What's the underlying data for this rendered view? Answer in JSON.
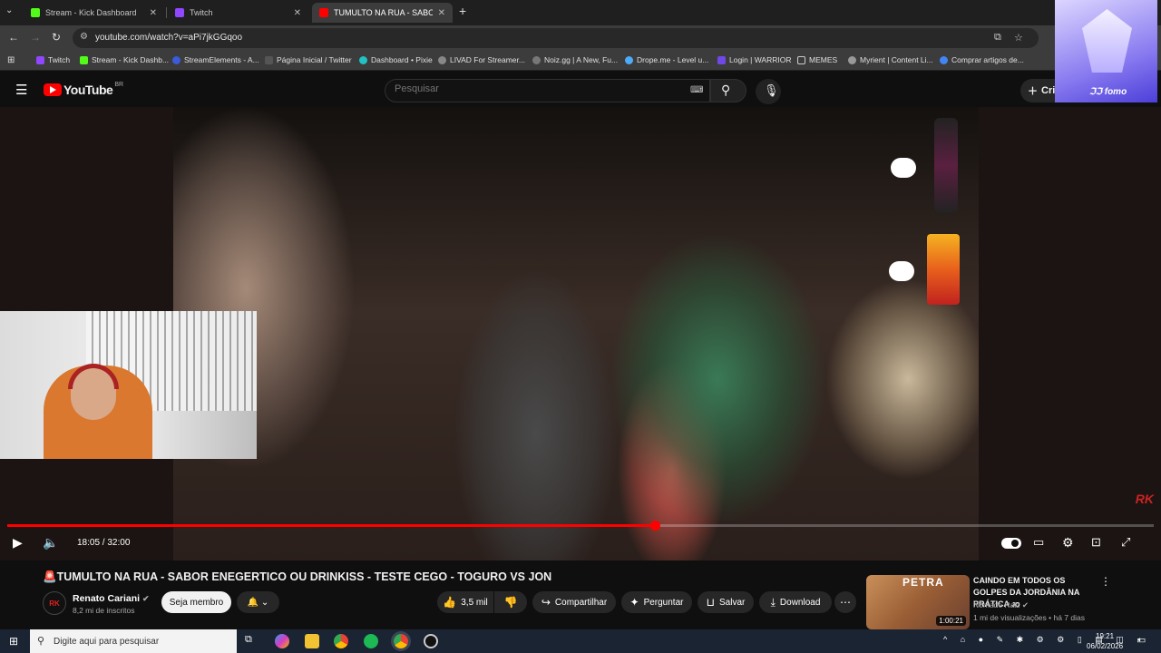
{
  "browser": {
    "tabs": [
      {
        "label": "Stream - Kick Dashboard",
        "color": "#53fc18"
      },
      {
        "label": "Twitch",
        "color": "#9146ff"
      },
      {
        "label": "TUMULTO NA RUA - SABOR",
        "color": "#ff0000"
      }
    ],
    "url": "youtube.com/watch?v=aPi7jkGGqoo",
    "bookmarks": [
      {
        "label": "Twitch",
        "color": "#9146ff"
      },
      {
        "label": "Stream - Kick Dashb...",
        "color": "#53fc18"
      },
      {
        "label": "StreamElements - A...",
        "color": "#3b5bdb"
      },
      {
        "label": "Página Inicial / Twitter",
        "color": "#555555"
      },
      {
        "label": "Dashboard • Pixie",
        "color": "#22c1c3"
      },
      {
        "label": "LIVAD For Streamer...",
        "color": "#888888"
      },
      {
        "label": "Noiz.gg | A New, Fu...",
        "color": "#777777"
      },
      {
        "label": "Drope.me - Level u...",
        "color": "#4dabf7"
      },
      {
        "label": "Login | WARRIOR",
        "color": "#7048e8"
      },
      {
        "label": "MEMES",
        "color": "#cccccc"
      },
      {
        "label": "Myrient | Content Li...",
        "color": "#999999"
      },
      {
        "label": "Comprar artigos de...",
        "color": "#4285f4"
      }
    ]
  },
  "youtube": {
    "logo": "YouTube",
    "region": "BR",
    "search_placeholder": "Pesquisar",
    "create_label": "Cri"
  },
  "player": {
    "time": "18:05 / 32:00",
    "progress": 0.565,
    "watermark": "RK"
  },
  "video": {
    "title": "🚨TUMULTO NA RUA - SABOR ENEGERTICO OU DRINKISS - TESTE CEGO - TOGURO VS JON",
    "channel": "Renato Cariani",
    "channel_initials": "RK",
    "subscribers": "8,2 mi de inscritos",
    "join_label": "Seja membro",
    "likes": "3,5 mil",
    "share_label": "Compartilhar",
    "ask_label": "Perguntar",
    "save_label": "Salvar",
    "download_label": "Download"
  },
  "recommendation": {
    "thumb_text": "PETRA",
    "duration": "1:00:21",
    "title": "CAINDO EM TODOS OS GOLPES DA JORDÂNIA NA PRÁTICA",
    "title_suffix": "JO",
    "channel": "Nômade Raiz",
    "meta": "1 mi de visualizações • há 7 dias"
  },
  "overlay": {
    "brand": "fomo"
  },
  "taskbar": {
    "search_placeholder": "Digite aqui para pesquisar",
    "time": "19:21",
    "date": "06/02/2026"
  }
}
